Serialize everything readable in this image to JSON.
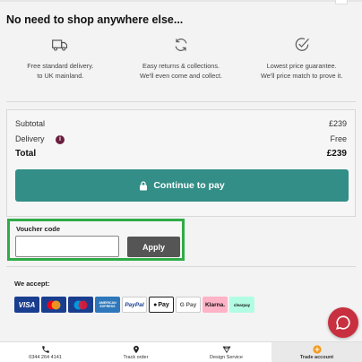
{
  "heading": "No need to shop anywhere else...",
  "benefits": [
    {
      "icon": "delivery-truck-icon",
      "line1": "Free standard delivery.",
      "line2": "to UK mainland."
    },
    {
      "icon": "returns-arrows-icon",
      "line1": "Easy returns & collections.",
      "line2": "We'll even come and collect."
    },
    {
      "icon": "price-tick-icon",
      "line1": "Lowest price guarantee.",
      "line2": "We'll price match to prove it."
    }
  ],
  "summary": {
    "subtotal_label": "Subtotal",
    "subtotal_value": "£239",
    "delivery_label": "Delivery",
    "delivery_value": "Free",
    "total_label": "Total",
    "total_value": "£239",
    "pay_label": "Continue to pay"
  },
  "voucher": {
    "label": "Voucher code",
    "value": "",
    "apply_label": "Apply"
  },
  "accept": {
    "label": "We accept:",
    "cards": [
      {
        "name": "visa",
        "label": "VISA",
        "color": "#1a3e8f"
      },
      {
        "name": "mastercard",
        "label": "",
        "color": "#1a3e8f"
      },
      {
        "name": "maestro",
        "label": "",
        "color": "#1a3e8f"
      },
      {
        "name": "american-express",
        "label": "AMERICAN EXPRESS",
        "color": "#2e77bb"
      },
      {
        "name": "paypal",
        "label": "PayPal",
        "color": "#ffffff"
      },
      {
        "name": "apple-pay",
        "label": "Pay",
        "color": "#ffffff"
      },
      {
        "name": "google-pay",
        "label": "G Pay",
        "color": "#ffffff"
      },
      {
        "name": "klarna",
        "label": "Klarna.",
        "color": "#ffb3c7"
      },
      {
        "name": "clearpay",
        "label": "clearpay",
        "color": "#b2fce4"
      }
    ]
  },
  "bottom_nav": [
    {
      "icon": "phone-icon",
      "label": "0344 264 4141"
    },
    {
      "icon": "location-pin-icon",
      "label": "Track order"
    },
    {
      "icon": "design-diamond-icon",
      "label": "Design Service"
    },
    {
      "icon": "plus-circle-icon",
      "label": "Trade account"
    }
  ],
  "colors": {
    "accent": "#328e86",
    "voucher_highlight": "#2fab48",
    "info_dot": "#6a1f3d",
    "chat": "#c8303f",
    "trade_icon": "#f39a1e"
  }
}
